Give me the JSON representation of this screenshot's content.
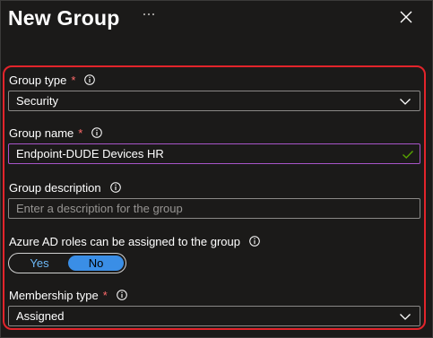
{
  "panel": {
    "title": "New Group",
    "more_label": "···"
  },
  "fields": {
    "group_type": {
      "label": "Group type",
      "required_mark": "*",
      "value": "Security"
    },
    "group_name": {
      "label": "Group name",
      "required_mark": "*",
      "value": "Endpoint-DUDE Devices HR"
    },
    "group_description": {
      "label": "Group description",
      "placeholder": "Enter a description for the group"
    },
    "azure_ad_roles": {
      "label": "Azure AD roles can be assigned to the group",
      "options": [
        "Yes",
        "No"
      ],
      "selected": "No"
    },
    "membership_type": {
      "label": "Membership type",
      "required_mark": "*",
      "value": "Assigned"
    }
  },
  "colors": {
    "background": "#1b1a19",
    "highlight_border": "#e3242b",
    "required": "#ff6b6b",
    "toggle_selected": "#3a8ee6",
    "valid_check": "#57a300",
    "focus_border": "#a855c8"
  },
  "icons": {
    "close": "close-icon",
    "info": "info-icon",
    "chevron": "chevron-down-icon",
    "valid": "checkmark-icon"
  }
}
